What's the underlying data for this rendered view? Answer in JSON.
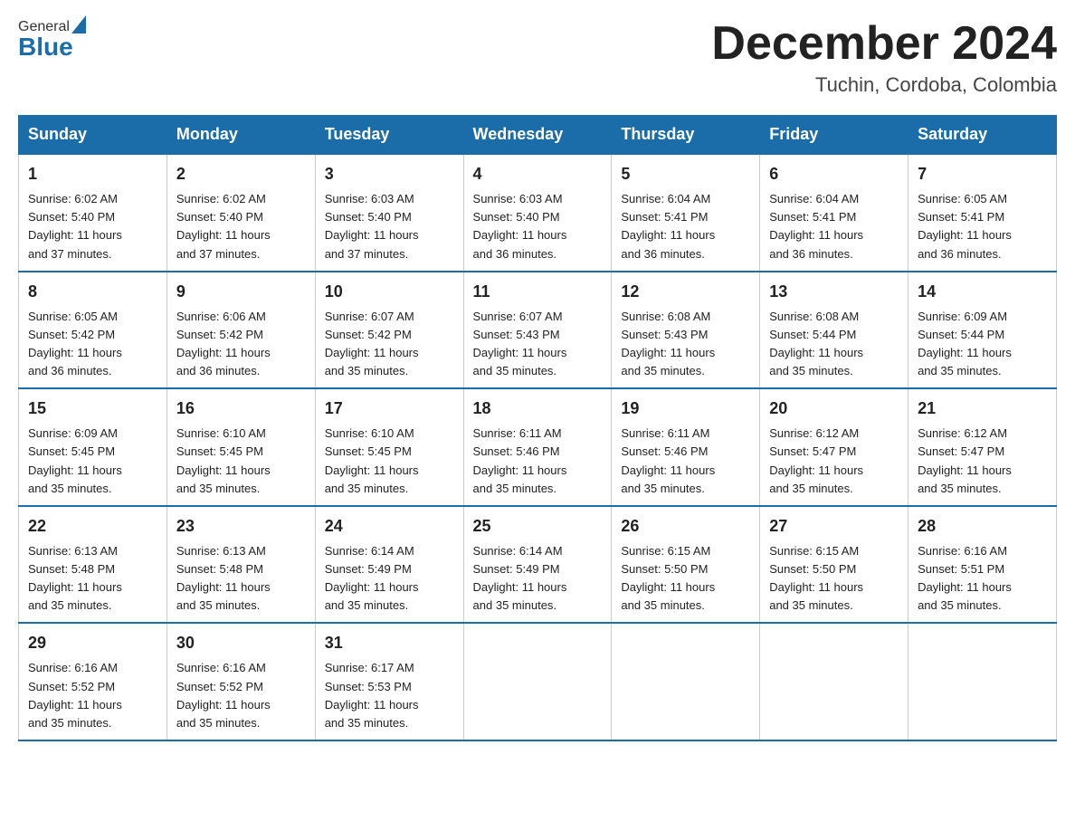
{
  "logo": {
    "general": "General",
    "blue": "Blue"
  },
  "title": {
    "month_year": "December 2024",
    "location": "Tuchin, Cordoba, Colombia"
  },
  "days_of_week": [
    "Sunday",
    "Monday",
    "Tuesday",
    "Wednesday",
    "Thursday",
    "Friday",
    "Saturday"
  ],
  "weeks": [
    [
      {
        "day": "1",
        "sunrise": "6:02 AM",
        "sunset": "5:40 PM",
        "daylight": "11 hours and 37 minutes."
      },
      {
        "day": "2",
        "sunrise": "6:02 AM",
        "sunset": "5:40 PM",
        "daylight": "11 hours and 37 minutes."
      },
      {
        "day": "3",
        "sunrise": "6:03 AM",
        "sunset": "5:40 PM",
        "daylight": "11 hours and 37 minutes."
      },
      {
        "day": "4",
        "sunrise": "6:03 AM",
        "sunset": "5:40 PM",
        "daylight": "11 hours and 36 minutes."
      },
      {
        "day": "5",
        "sunrise": "6:04 AM",
        "sunset": "5:41 PM",
        "daylight": "11 hours and 36 minutes."
      },
      {
        "day": "6",
        "sunrise": "6:04 AM",
        "sunset": "5:41 PM",
        "daylight": "11 hours and 36 minutes."
      },
      {
        "day": "7",
        "sunrise": "6:05 AM",
        "sunset": "5:41 PM",
        "daylight": "11 hours and 36 minutes."
      }
    ],
    [
      {
        "day": "8",
        "sunrise": "6:05 AM",
        "sunset": "5:42 PM",
        "daylight": "11 hours and 36 minutes."
      },
      {
        "day": "9",
        "sunrise": "6:06 AM",
        "sunset": "5:42 PM",
        "daylight": "11 hours and 36 minutes."
      },
      {
        "day": "10",
        "sunrise": "6:07 AM",
        "sunset": "5:42 PM",
        "daylight": "11 hours and 35 minutes."
      },
      {
        "day": "11",
        "sunrise": "6:07 AM",
        "sunset": "5:43 PM",
        "daylight": "11 hours and 35 minutes."
      },
      {
        "day": "12",
        "sunrise": "6:08 AM",
        "sunset": "5:43 PM",
        "daylight": "11 hours and 35 minutes."
      },
      {
        "day": "13",
        "sunrise": "6:08 AM",
        "sunset": "5:44 PM",
        "daylight": "11 hours and 35 minutes."
      },
      {
        "day": "14",
        "sunrise": "6:09 AM",
        "sunset": "5:44 PM",
        "daylight": "11 hours and 35 minutes."
      }
    ],
    [
      {
        "day": "15",
        "sunrise": "6:09 AM",
        "sunset": "5:45 PM",
        "daylight": "11 hours and 35 minutes."
      },
      {
        "day": "16",
        "sunrise": "6:10 AM",
        "sunset": "5:45 PM",
        "daylight": "11 hours and 35 minutes."
      },
      {
        "day": "17",
        "sunrise": "6:10 AM",
        "sunset": "5:45 PM",
        "daylight": "11 hours and 35 minutes."
      },
      {
        "day": "18",
        "sunrise": "6:11 AM",
        "sunset": "5:46 PM",
        "daylight": "11 hours and 35 minutes."
      },
      {
        "day": "19",
        "sunrise": "6:11 AM",
        "sunset": "5:46 PM",
        "daylight": "11 hours and 35 minutes."
      },
      {
        "day": "20",
        "sunrise": "6:12 AM",
        "sunset": "5:47 PM",
        "daylight": "11 hours and 35 minutes."
      },
      {
        "day": "21",
        "sunrise": "6:12 AM",
        "sunset": "5:47 PM",
        "daylight": "11 hours and 35 minutes."
      }
    ],
    [
      {
        "day": "22",
        "sunrise": "6:13 AM",
        "sunset": "5:48 PM",
        "daylight": "11 hours and 35 minutes."
      },
      {
        "day": "23",
        "sunrise": "6:13 AM",
        "sunset": "5:48 PM",
        "daylight": "11 hours and 35 minutes."
      },
      {
        "day": "24",
        "sunrise": "6:14 AM",
        "sunset": "5:49 PM",
        "daylight": "11 hours and 35 minutes."
      },
      {
        "day": "25",
        "sunrise": "6:14 AM",
        "sunset": "5:49 PM",
        "daylight": "11 hours and 35 minutes."
      },
      {
        "day": "26",
        "sunrise": "6:15 AM",
        "sunset": "5:50 PM",
        "daylight": "11 hours and 35 minutes."
      },
      {
        "day": "27",
        "sunrise": "6:15 AM",
        "sunset": "5:50 PM",
        "daylight": "11 hours and 35 minutes."
      },
      {
        "day": "28",
        "sunrise": "6:16 AM",
        "sunset": "5:51 PM",
        "daylight": "11 hours and 35 minutes."
      }
    ],
    [
      {
        "day": "29",
        "sunrise": "6:16 AM",
        "sunset": "5:52 PM",
        "daylight": "11 hours and 35 minutes."
      },
      {
        "day": "30",
        "sunrise": "6:16 AM",
        "sunset": "5:52 PM",
        "daylight": "11 hours and 35 minutes."
      },
      {
        "day": "31",
        "sunrise": "6:17 AM",
        "sunset": "5:53 PM",
        "daylight": "11 hours and 35 minutes."
      },
      null,
      null,
      null,
      null
    ]
  ],
  "labels": {
    "sunrise": "Sunrise:",
    "sunset": "Sunset:",
    "daylight": "Daylight:"
  },
  "colors": {
    "header_bg": "#1a6da8",
    "header_text": "#ffffff",
    "border": "#1a6da8"
  }
}
